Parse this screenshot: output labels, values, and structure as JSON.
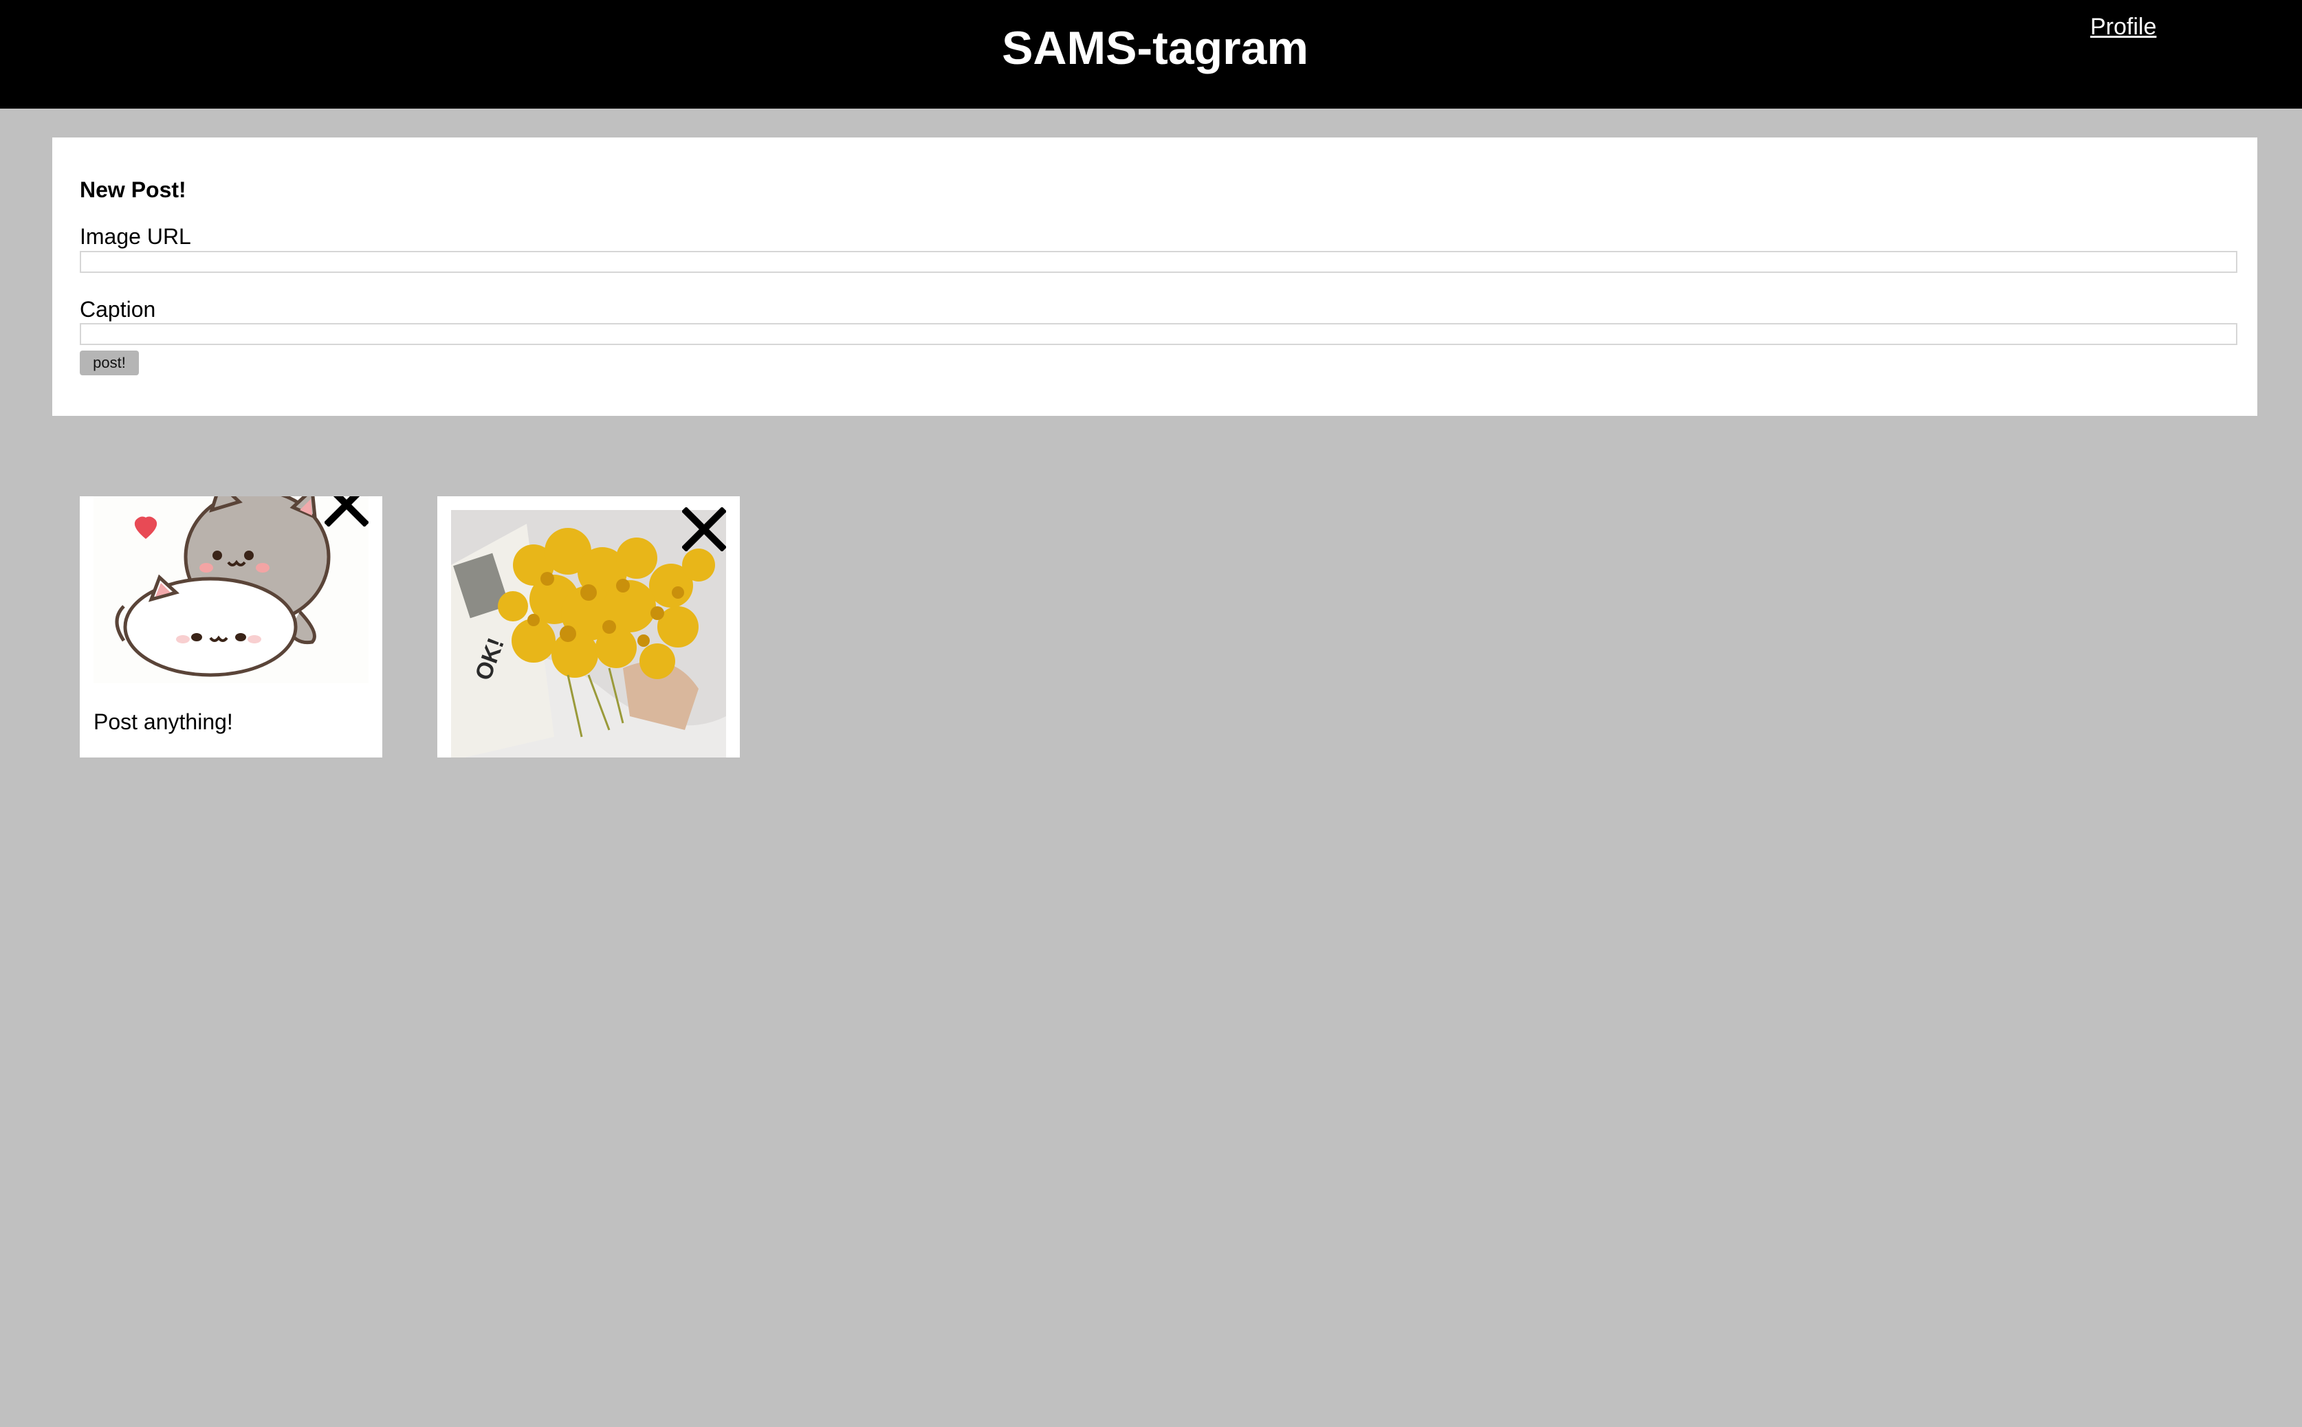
{
  "header": {
    "title": "SAMS-tagram",
    "profile_link": "Profile"
  },
  "new_post_form": {
    "heading": "New Post!",
    "image_url_label": "Image URL",
    "image_url_value": "",
    "caption_label": "Caption",
    "caption_value": "",
    "submit_label": "post!"
  },
  "posts": [
    {
      "image": "cartoon-cats-sticker",
      "caption": "Post anything!",
      "delete_icon": "close-icon"
    },
    {
      "image": "yellow-flowers-photo",
      "caption": "",
      "delete_icon": "close-icon"
    }
  ],
  "colors": {
    "page_background": "#c0c0c0",
    "header_background": "#000000",
    "card_background": "#ffffff",
    "button_background": "#b5b5b5"
  }
}
